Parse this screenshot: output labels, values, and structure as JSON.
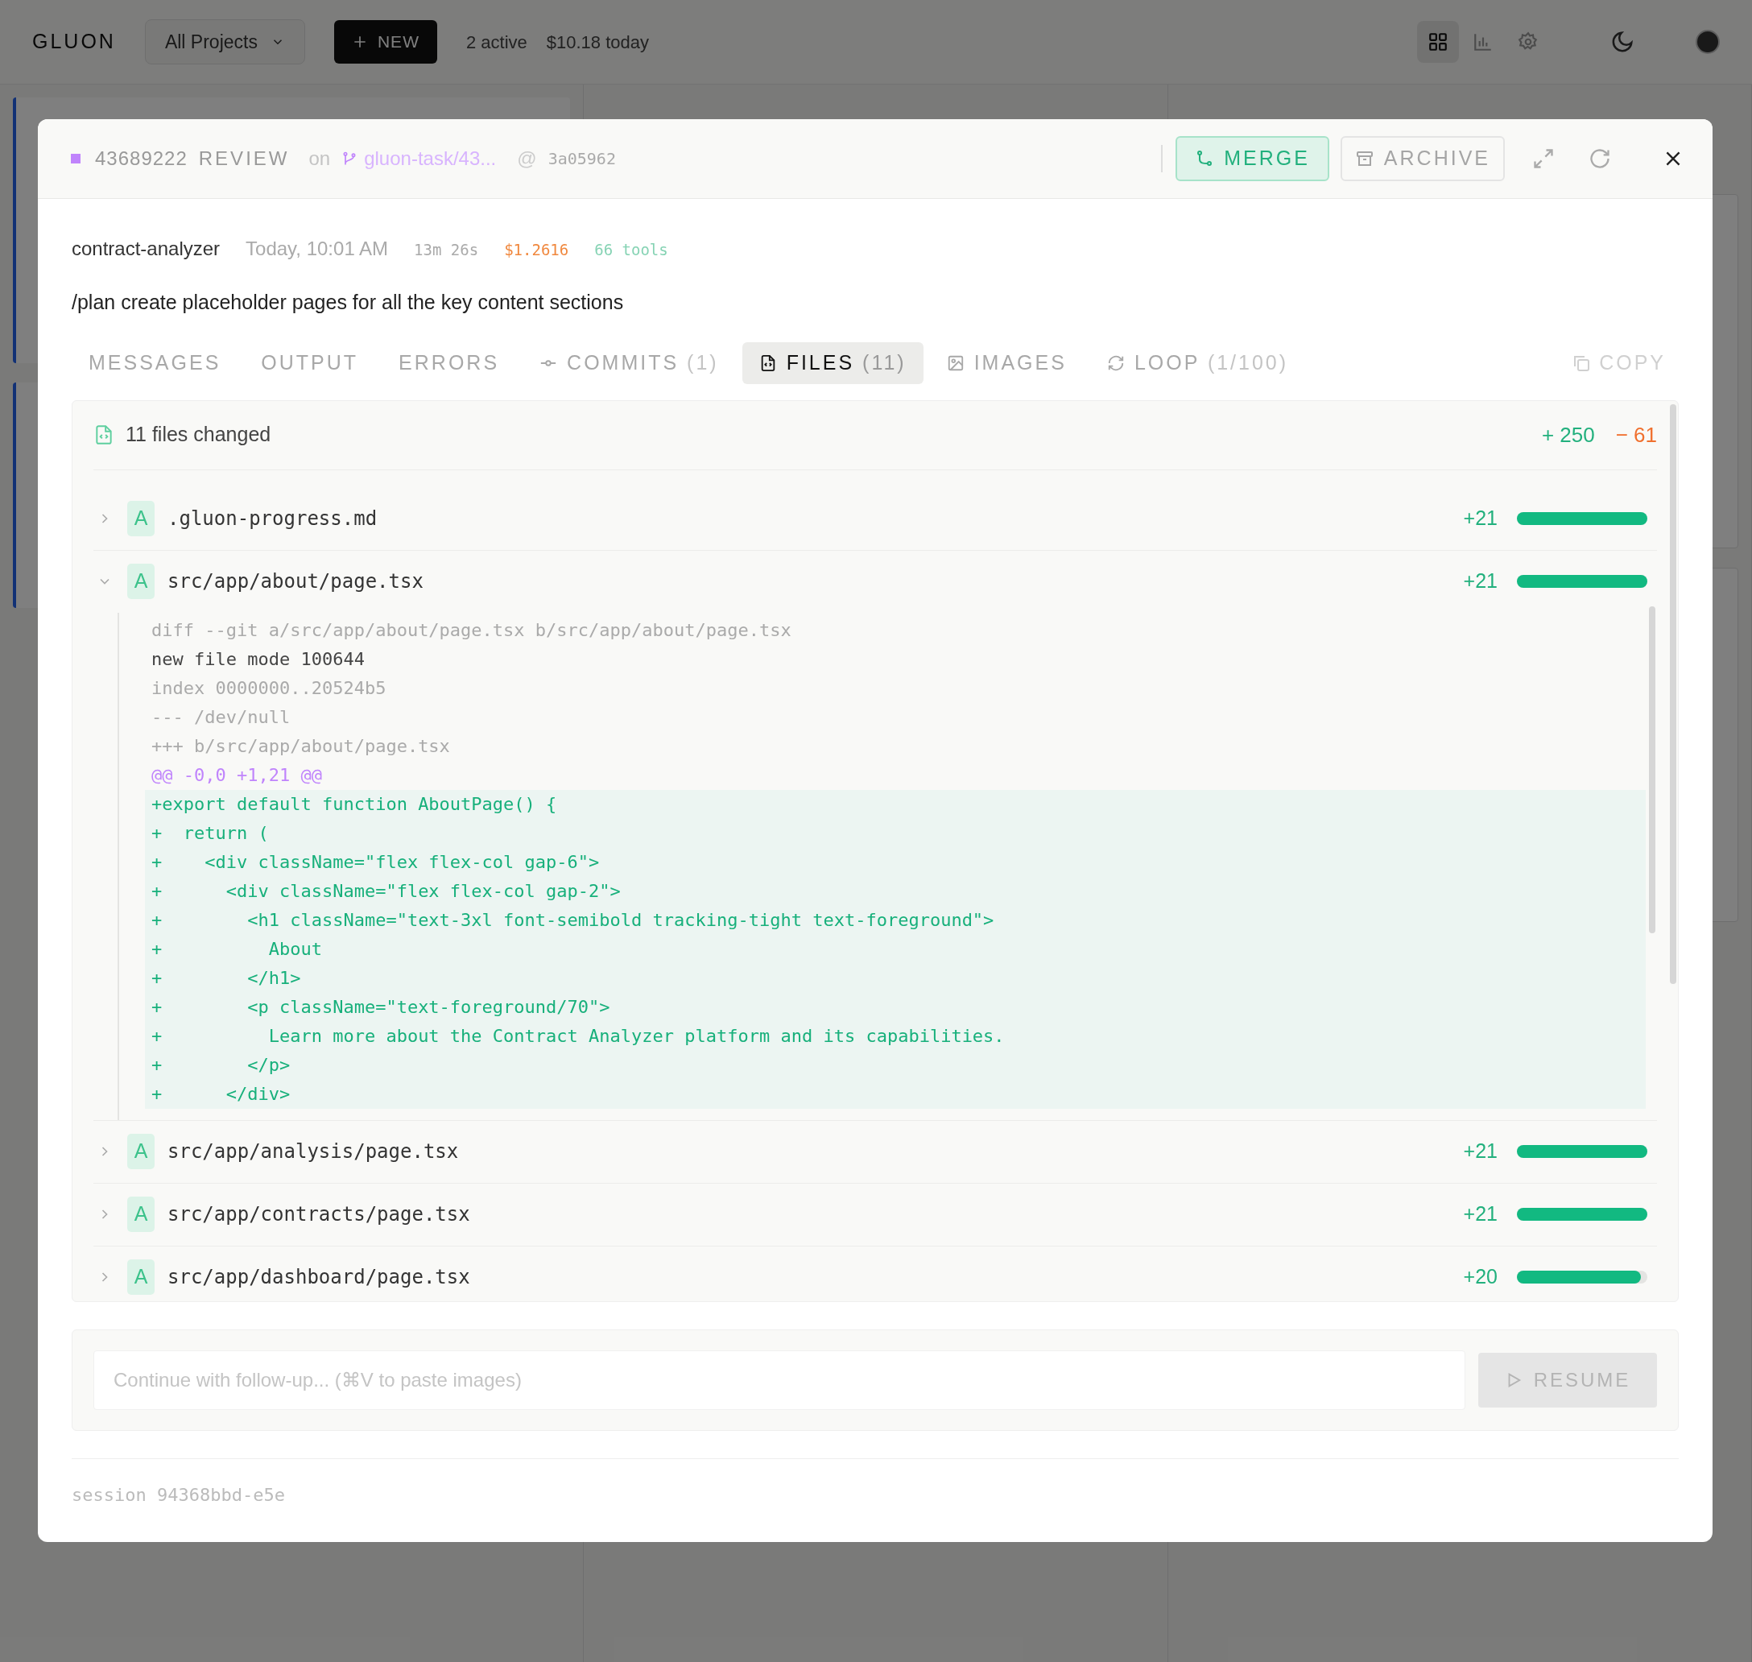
{
  "topbar": {
    "logo": "GLUON",
    "project_select": "All Projects",
    "new_button": "NEW",
    "active": "2 active",
    "cost": "$10.18 today",
    "views": [
      {
        "kind": "grid",
        "selected": true
      },
      {
        "kind": "chart",
        "selected": false
      },
      {
        "kind": "settings",
        "selected": false
      }
    ]
  },
  "modal": {
    "header": {
      "task_id": "43689222",
      "status": "REVIEW",
      "on": "on",
      "branch": "gluon-task/43...",
      "at": "@",
      "commit": "3a05962",
      "merge": "MERGE",
      "archive": "ARCHIVE"
    },
    "meta": {
      "project": "contract-analyzer",
      "time": "Today, 10:01 AM",
      "duration": "13m 26s",
      "cost": "$1.2616",
      "tools": "66 tools"
    },
    "prompt": "/plan create placeholder pages for all the key content sections",
    "tabs": [
      {
        "label": "MESSAGES",
        "kind": "plain",
        "selected": false
      },
      {
        "label": "OUTPUT",
        "kind": "plain",
        "selected": false
      },
      {
        "label": "ERRORS",
        "kind": "plain",
        "selected": false
      },
      {
        "label": "COMMITS",
        "count": "(1)",
        "kind": "commit",
        "selected": false
      },
      {
        "label": "FILES",
        "count": "(11)",
        "kind": "file",
        "selected": true
      },
      {
        "label": "IMAGES",
        "kind": "image",
        "selected": false
      },
      {
        "label": "LOOP",
        "count": "(1/100)",
        "kind": "loop",
        "selected": false
      }
    ],
    "copy": "COPY",
    "files_summary": {
      "label": "11 files changed",
      "added": "+ 250",
      "removed": "− 61"
    },
    "files": [
      {
        "status": "A",
        "path": ".gluon-progress.md",
        "count": "+21",
        "level": 1,
        "expanded": false
      },
      {
        "status": "A",
        "path": "src/app/about/page.tsx",
        "count": "+21",
        "level": 1,
        "expanded": true,
        "diff": [
          {
            "kind": "meta",
            "text": "diff --git a/src/app/about/page.tsx b/src/app/about/page.tsx"
          },
          {
            "kind": "mode",
            "text": "new file mode 100644"
          },
          {
            "kind": "meta",
            "text": "index 0000000..20524b5"
          },
          {
            "kind": "meta",
            "text": "--- /dev/null"
          },
          {
            "kind": "meta",
            "text": "+++ b/src/app/about/page.tsx"
          },
          {
            "kind": "hunk",
            "text": "@@ -0,0 +1,21 @@"
          },
          {
            "kind": "add",
            "text": "+export default function AboutPage() {"
          },
          {
            "kind": "add",
            "text": "+  return ("
          },
          {
            "kind": "add",
            "text": "+    <div className=\"flex flex-col gap-6\">"
          },
          {
            "kind": "add",
            "text": "+      <div className=\"flex flex-col gap-2\">"
          },
          {
            "kind": "add",
            "text": "+        <h1 className=\"text-3xl font-semibold tracking-tight text-foreground\">"
          },
          {
            "kind": "add",
            "text": "+          About"
          },
          {
            "kind": "add",
            "text": "+        </h1>"
          },
          {
            "kind": "add",
            "text": "+        <p className=\"text-foreground/70\">"
          },
          {
            "kind": "add",
            "text": "+          Learn more about the Contract Analyzer platform and its capabilities."
          },
          {
            "kind": "add",
            "text": "+        </p>"
          },
          {
            "kind": "add",
            "text": "+      </div>"
          }
        ]
      },
      {
        "status": "A",
        "path": "src/app/analysis/page.tsx",
        "count": "+21",
        "level": 1,
        "expanded": false
      },
      {
        "status": "A",
        "path": "src/app/contracts/page.tsx",
        "count": "+21",
        "level": 1,
        "expanded": false
      },
      {
        "status": "A",
        "path": "src/app/dashboard/page.tsx",
        "count": "+20",
        "level": 0.95,
        "expanded": false
      }
    ],
    "followup": {
      "placeholder": "Continue with follow-up... (⌘V to paste images)",
      "resume": "RESUME"
    },
    "session": "session 94368bbd-e5e"
  }
}
